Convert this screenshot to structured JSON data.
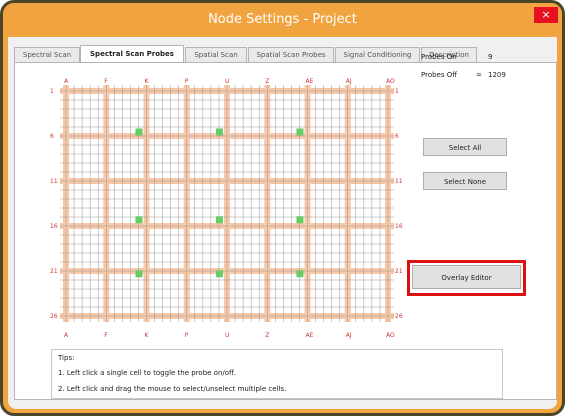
{
  "window": {
    "title": "Node Settings - Project",
    "close_glyph": "×"
  },
  "tabs": [
    {
      "label": "Spectral Scan",
      "active": false
    },
    {
      "label": "Spectral Scan Probes",
      "active": true
    },
    {
      "label": "Spatial Scan",
      "active": false
    },
    {
      "label": "Spatial Scan Probes",
      "active": false
    },
    {
      "label": "Signal Conditioning",
      "active": false
    },
    {
      "label": "Description",
      "active": false
    }
  ],
  "grid": {
    "col_labels": [
      "A",
      "F",
      "K",
      "P",
      "U",
      "Z",
      "AE",
      "AJ",
      "AO"
    ],
    "row_labels": [
      "1",
      "6",
      "11",
      "16",
      "21",
      "26"
    ],
    "colors": {
      "highlight": "#f7c9a8",
      "line": "#999999",
      "probe_on": "#66cc66",
      "label": "#cc3333"
    }
  },
  "probes": {
    "on_label": "Probes On",
    "on_value": "9",
    "off_label": "Probes Off",
    "off_equals": "=",
    "off_value": "1209"
  },
  "buttons": {
    "select_all": "Select All",
    "select_none": "Select None",
    "overlay_editor": "Overlay Editor"
  },
  "tips": {
    "heading": "Tips:",
    "lines": [
      "1. Left click a single cell to toggle the probe on/off.",
      "2. Left click and drag the mouse to select/unselect multiple cells."
    ]
  }
}
